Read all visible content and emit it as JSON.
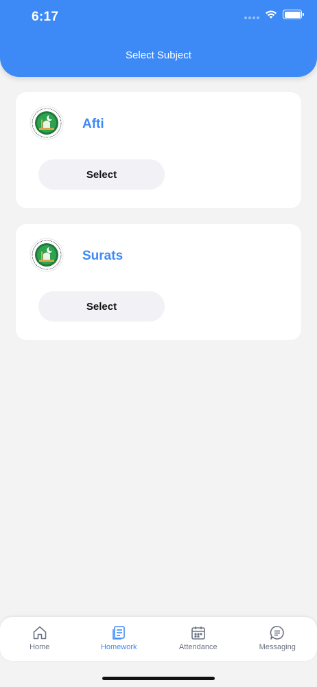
{
  "status_bar": {
    "time": "6:17"
  },
  "header": {
    "title": "Select Subject"
  },
  "subjects": [
    {
      "name": "Afti",
      "button_label": "Select"
    },
    {
      "name": "Surats",
      "button_label": "Select"
    }
  ],
  "tabs": [
    {
      "label": "Home",
      "icon": "home-icon",
      "active": false
    },
    {
      "label": "Homework",
      "icon": "homework-icon",
      "active": true
    },
    {
      "label": "Attendance",
      "icon": "calendar-icon",
      "active": false
    },
    {
      "label": "Messaging",
      "icon": "chat-icon",
      "active": false
    }
  ],
  "colors": {
    "accent": "#3d8af7",
    "background": "#f3f3f3",
    "button_bg": "#f1f1f6"
  }
}
